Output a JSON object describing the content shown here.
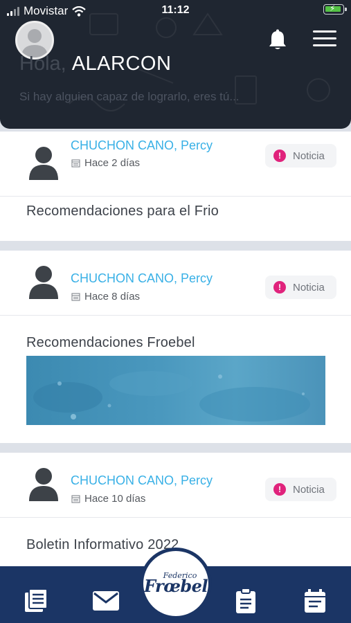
{
  "status_bar": {
    "carrier": "Movistar",
    "time": "11:12"
  },
  "header": {
    "greeting": "Hola,",
    "user_name": "ALARCON",
    "motto": "Si hay alguien capaz de lograrlo, eres tú..."
  },
  "posts": [
    {
      "author": "CHUCHON CANO, Percy",
      "date": "Hace 2 días",
      "badge": "Noticia",
      "title": "Recomendaciones para el Frio",
      "has_image": false
    },
    {
      "author": "CHUCHON CANO, Percy",
      "date": "Hace 8 días",
      "badge": "Noticia",
      "title": "Recomendaciones Froebel",
      "has_image": true
    },
    {
      "author": "CHUCHON CANO, Percy",
      "date": "Hace 10 días",
      "badge": "Noticia",
      "title": "Boletin Informativo 2022",
      "has_image": false
    }
  ],
  "bottom_nav": {
    "logo_top": "Federico",
    "logo_main": "Frœbel",
    "items": [
      "news-icon",
      "mail-icon",
      "clipboard-icon",
      "calendar-icon"
    ]
  },
  "colors": {
    "header_bg": "#1f2631",
    "nav_bg": "#1b3565",
    "author": "#38b0e6",
    "badge_accent": "#e0237c"
  }
}
